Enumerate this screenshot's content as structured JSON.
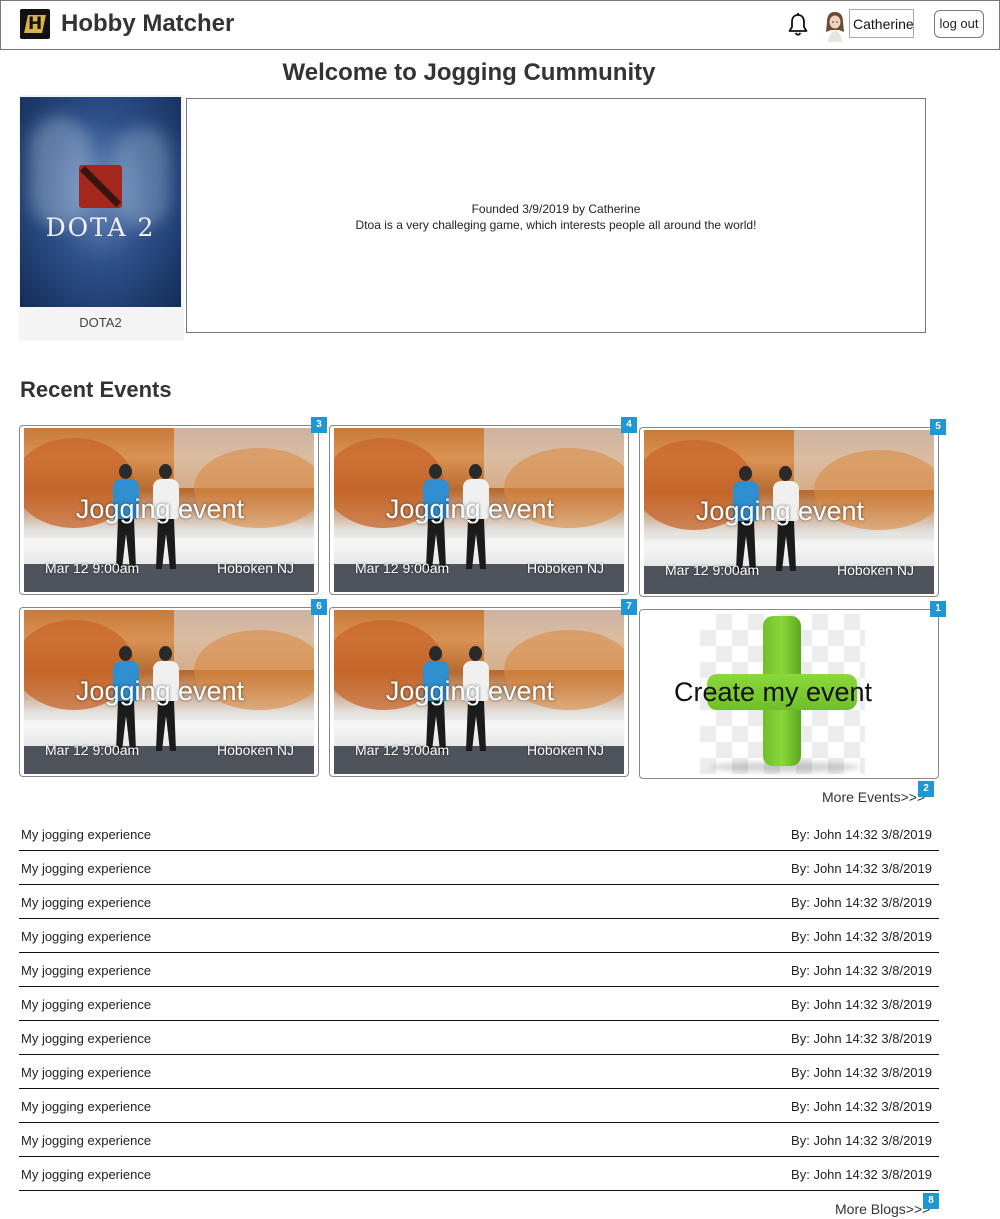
{
  "header": {
    "app_title": "Hobby Matcher",
    "username": "Catherine",
    "logout_label": "log out",
    "icons": [
      "logo-icon",
      "bell-icon",
      "avatar-icon"
    ]
  },
  "page": {
    "welcome": "Welcome to Jogging Cummunity"
  },
  "community": {
    "image_text": "DOTA 2",
    "name": "DOTA2",
    "founded": "Founded 3/9/2019 by Catherine",
    "description": "Dtoa is a very challeging game, which interests people all around the world!"
  },
  "recent_events": {
    "title": "Recent Events",
    "events": [
      {
        "title": "Jogging event",
        "date": "Mar 12 9:00am",
        "location": "Hoboken NJ",
        "badge": "3"
      },
      {
        "title": "Jogging event",
        "date": "Mar 12 9:00am",
        "location": "Hoboken NJ",
        "badge": "4"
      },
      {
        "title": "Jogging event",
        "date": "Mar 12 9:00am",
        "location": "Hoboken NJ",
        "badge": "5"
      },
      {
        "title": "Jogging event",
        "date": "Mar 12 9:00am",
        "location": "Hoboken NJ",
        "badge": "6"
      },
      {
        "title": "Jogging event",
        "date": "Mar 12 9:00am",
        "location": "Hoboken NJ",
        "badge": "7"
      }
    ],
    "create": {
      "label": "Create my event",
      "badge": "1"
    },
    "more": {
      "label": "More Events>>>",
      "badge": "2"
    }
  },
  "blogs": {
    "items": [
      {
        "title": "My jogging experience",
        "meta": "By: John 14:32 3/8/2019"
      },
      {
        "title": "My jogging experience",
        "meta": "By: John 14:32 3/8/2019"
      },
      {
        "title": "My jogging experience",
        "meta": "By: John 14:32 3/8/2019"
      },
      {
        "title": "My jogging experience",
        "meta": "By: John 14:32 3/8/2019"
      },
      {
        "title": "My jogging experience",
        "meta": "By: John 14:32 3/8/2019"
      },
      {
        "title": "My jogging experience",
        "meta": "By: John 14:32 3/8/2019"
      },
      {
        "title": "My jogging experience",
        "meta": "By: John 14:32 3/8/2019"
      },
      {
        "title": "My jogging experience",
        "meta": "By: John 14:32 3/8/2019"
      },
      {
        "title": "My jogging experience",
        "meta": "By: John 14:32 3/8/2019"
      },
      {
        "title": "My jogging experience",
        "meta": "By: John 14:32 3/8/2019"
      },
      {
        "title": "My jogging experience",
        "meta": "By: John 14:32 3/8/2019"
      }
    ],
    "more": {
      "label": "More Blogs>>>",
      "badge": "8"
    }
  },
  "colors": {
    "badge": "#1f97d4",
    "plus_green": "#7cc936"
  }
}
